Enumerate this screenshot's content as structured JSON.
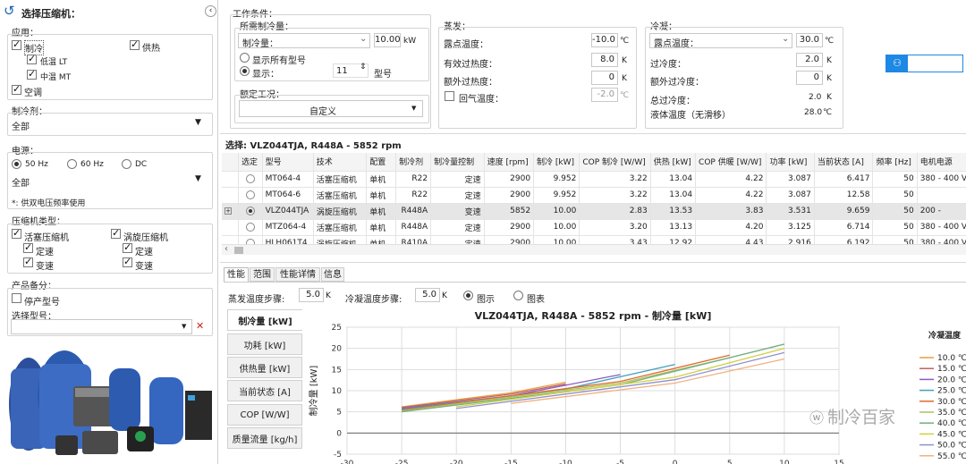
{
  "left": {
    "title": "选择压缩机：",
    "app_label": "应用：",
    "apps": {
      "refrigeration": "制冷",
      "heating": "供热",
      "low_temp": "低温 LT",
      "mid_temp": "中温 MT",
      "ac": "空调"
    },
    "refrigerant_label": "制冷剂：",
    "refrigerant_value": "全部",
    "power_label": "电源：",
    "freq": [
      "50 Hz",
      "60 Hz",
      "DC"
    ],
    "power_value": "全部",
    "note": "*: 供双电压频率使用",
    "type_label": "压缩机类型：",
    "types": {
      "piston": "活塞压缩机",
      "scroll": "涡旋压缩机",
      "fixed1": "定速",
      "variable1": "变速",
      "fixed2": "定速",
      "variable2": "变速"
    },
    "product_label": "产品备分：",
    "discontinued": "停产型号",
    "select_model_label": "选择型号："
  },
  "work": {
    "title": "工作条件：",
    "required_label": "所需制冷量：",
    "capacity_select": "制冷量：",
    "capacity_value": "10.00",
    "capacity_unit": "kW",
    "show_all": "显示所有型号",
    "show": "显示：",
    "show_count": "11",
    "model_unit": "型号",
    "rated_label": "额定工况：",
    "rated_value": "自定义"
  },
  "evap": {
    "title": "蒸发：",
    "dew_label": "露点温度：",
    "dew_value": "-10.0",
    "dew_unit": "℃",
    "superheat_label": "有效过热度：",
    "superheat_value": "8.0",
    "superheat_unit": "K",
    "extra_label": "额外过热度：",
    "extra_value": "0",
    "extra_unit": "K",
    "return_label": "回气温度：",
    "return_value": "-2.0",
    "return_unit": "℃"
  },
  "cond": {
    "title": "冷凝：",
    "select": "露点温度：",
    "value": "30.0",
    "unit": "℃",
    "subcool_label": "过冷度：",
    "subcool_value": "2.0",
    "subcool_unit": "K",
    "extra_label": "额外过冷度：",
    "extra_value": "0",
    "extra_unit": "K",
    "total_label": "总过冷度：",
    "total_value": "2.0",
    "total_unit": "K",
    "liquid_label": "液体温度（无滑移）",
    "liquid_value": "28.0",
    "liquid_unit": "℃"
  },
  "selection": "选择: VLZ044TJA, R448A - 5852 rpm",
  "table": {
    "headers": [
      "选定",
      "型号",
      "技术",
      "配置",
      "制冷剂",
      "制冷量控制",
      "速度 [rpm]",
      "制冷 [kW]",
      "COP 制冷 [W/W]",
      "供热 [kW]",
      "COP 供暖 [W/W]",
      "功率 [kW]",
      "当前状态 [A]",
      "频率 [Hz]",
      "电机电源"
    ],
    "rows": [
      [
        "",
        "MT064-4",
        "活塞压缩机",
        "单机",
        "R22",
        "定速",
        "2900",
        "9.952",
        "3.22",
        "13.04",
        "4.22",
        "3.087",
        "6.417",
        "50",
        "380 - 400 V (4"
      ],
      [
        "",
        "MT064-6",
        "活塞压缩机",
        "单机",
        "R22",
        "定速",
        "2900",
        "9.952",
        "3.22",
        "13.04",
        "4.22",
        "3.087",
        "12.58",
        "50",
        ""
      ],
      [
        "",
        "VLZ044TJA",
        "涡旋压缩机",
        "单机",
        "R448A",
        "变速",
        "5852",
        "10.00",
        "2.83",
        "13.53",
        "3.83",
        "3.531",
        "9.659",
        "50",
        "200 -"
      ],
      [
        "",
        "MTZ064-4",
        "活塞压缩机",
        "单机",
        "R448A",
        "定速",
        "2900",
        "10.00",
        "3.20",
        "13.13",
        "4.20",
        "3.125",
        "6.714",
        "50",
        "380 - 400 V (4"
      ],
      [
        "",
        "HLH061T4",
        "涡旋压缩机",
        "单机",
        "R410A",
        "定速",
        "2900",
        "10.00",
        "3.43",
        "12.92",
        "4.43",
        "2.916",
        "6.192",
        "50",
        "380 - 400 V (4"
      ]
    ]
  },
  "bottom_tabs": [
    "性能",
    "范围",
    "性能详情",
    "信息"
  ],
  "steps": {
    "evap_label": "蒸发温度步骤:",
    "evap_value": "5.0",
    "evap_unit": "K",
    "cond_label": "冷凝温度步骤:",
    "cond_value": "5.0",
    "cond_unit": "K",
    "chart_opt": "图示",
    "table_opt": "图表"
  },
  "side_tabs": [
    "制冷量 [kW]",
    "功耗 [kW]",
    "供热量 [kW]",
    "当前状态 [A]",
    "COP [W/W]",
    "质量流量 [kg/h]"
  ],
  "watermark": "制冷百家",
  "chart_data": {
    "type": "line",
    "title": "VLZ044TJA, R448A - 5852 rpm - 制冷量 [kW]",
    "ylabel": "制冷量 [kW]",
    "xlim": [
      -30,
      15
    ],
    "ylim": [
      -5,
      25
    ],
    "xticks": [
      -30,
      -25,
      -20,
      -15,
      -10,
      -5,
      0,
      5,
      10,
      15
    ],
    "yticks": [
      -5,
      0,
      5,
      10,
      15,
      20,
      25
    ],
    "legend_title": "冷凝温度",
    "series": [
      {
        "name": "10.0 ℃",
        "color": "#e8a040",
        "x": [
          -25,
          -15,
          -10
        ],
        "y": [
          6.2,
          9.5,
          12.0
        ]
      },
      {
        "name": "15.0 ℃",
        "color": "#c06060",
        "x": [
          -25,
          -15,
          -10
        ],
        "y": [
          6.0,
          9.2,
          11.6
        ]
      },
      {
        "name": "20.0 ℃",
        "color": "#8a5cc0",
        "x": [
          -25,
          -15,
          -5
        ],
        "y": [
          5.8,
          8.8,
          13.8
        ]
      },
      {
        "name": "25.0 ℃",
        "color": "#40a0c0",
        "x": [
          -25,
          -10,
          0
        ],
        "y": [
          5.6,
          10.4,
          16.2
        ]
      },
      {
        "name": "30.0 ℃",
        "color": "#e06a2a",
        "x": [
          -25,
          -5,
          5
        ],
        "y": [
          5.4,
          12.2,
          18.4
        ]
      },
      {
        "name": "35.0 ℃",
        "color": "#b0c060",
        "x": [
          -25,
          -5,
          5
        ],
        "y": [
          5.2,
          11.8,
          17.8
        ]
      },
      {
        "name": "40.0 ℃",
        "color": "#70b080",
        "x": [
          -25,
          -5,
          10
        ],
        "y": [
          5.0,
          11.4,
          21.0
        ]
      },
      {
        "name": "45.0 ℃",
        "color": "#d0d040",
        "x": [
          -20,
          0,
          10
        ],
        "y": [
          6.2,
          13.2,
          20.0
        ]
      },
      {
        "name": "50.0 ℃",
        "color": "#9090d0",
        "x": [
          -20,
          0,
          10
        ],
        "y": [
          5.8,
          12.6,
          19.0
        ]
      },
      {
        "name": "55.0 ℃",
        "color": "#f0b080",
        "x": [
          -15,
          0,
          10
        ],
        "y": [
          7.0,
          11.8,
          17.5
        ]
      }
    ]
  }
}
